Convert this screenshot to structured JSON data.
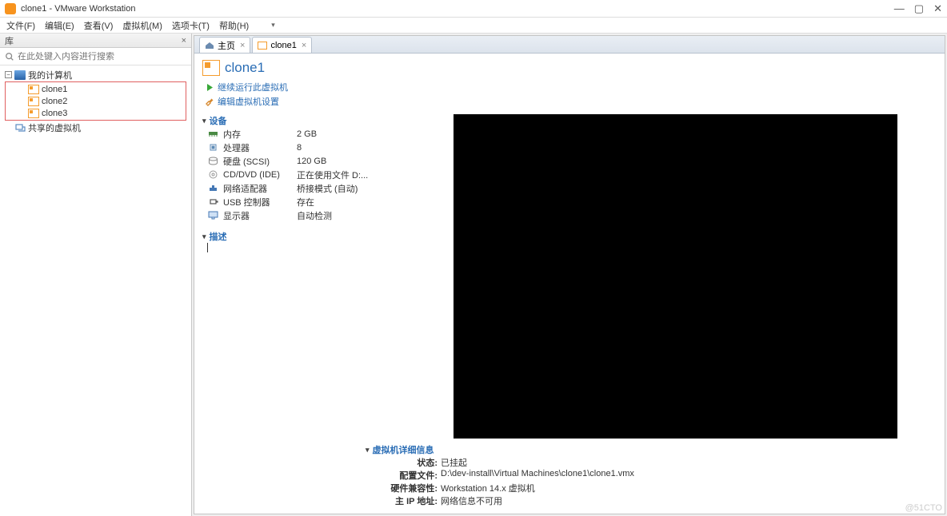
{
  "window": {
    "title": "clone1 - VMware Workstation"
  },
  "menu": {
    "file": "文件(F)",
    "edit": "编辑(E)",
    "view": "查看(V)",
    "vm": "虚拟机(M)",
    "tabs": "选项卡(T)",
    "help": "帮助(H)"
  },
  "sidebar": {
    "header": "库",
    "search_placeholder": "在此处键入内容进行搜索",
    "my_computer": "我的计算机",
    "vms": [
      "clone1",
      "clone2",
      "clone3"
    ],
    "shared": "共享的虚拟机"
  },
  "tabs": {
    "home": "主页",
    "active": "clone1"
  },
  "vm": {
    "name": "clone1",
    "action_resume": "继续运行此虚拟机",
    "action_edit": "编辑虚拟机设置",
    "section_devices": "设备",
    "devices": [
      {
        "icon": "mem",
        "name": "内存",
        "value": "2 GB"
      },
      {
        "icon": "cpu",
        "name": "处理器",
        "value": "8"
      },
      {
        "icon": "disk",
        "name": "硬盘 (SCSI)",
        "value": "120 GB"
      },
      {
        "icon": "cd",
        "name": "CD/DVD (IDE)",
        "value": "正在使用文件 D:..."
      },
      {
        "icon": "net",
        "name": "网络适配器",
        "value": "桥接模式 (自动)"
      },
      {
        "icon": "usb",
        "name": "USB 控制器",
        "value": "存在"
      },
      {
        "icon": "disp",
        "name": "显示器",
        "value": "自动检测"
      }
    ],
    "section_desc": "描述",
    "section_details": "虚拟机详细信息",
    "details": {
      "state_k": "状态:",
      "state_v": "已挂起",
      "config_k": "配置文件:",
      "config_v": "D:\\dev-install\\Virtual Machines\\clone1\\clone1.vmx",
      "compat_k": "硬件兼容性:",
      "compat_v": "Workstation 14.x 虚拟机",
      "ip_k": "主 IP 地址:",
      "ip_v": "网络信息不可用"
    }
  },
  "watermark": "@51CTO"
}
